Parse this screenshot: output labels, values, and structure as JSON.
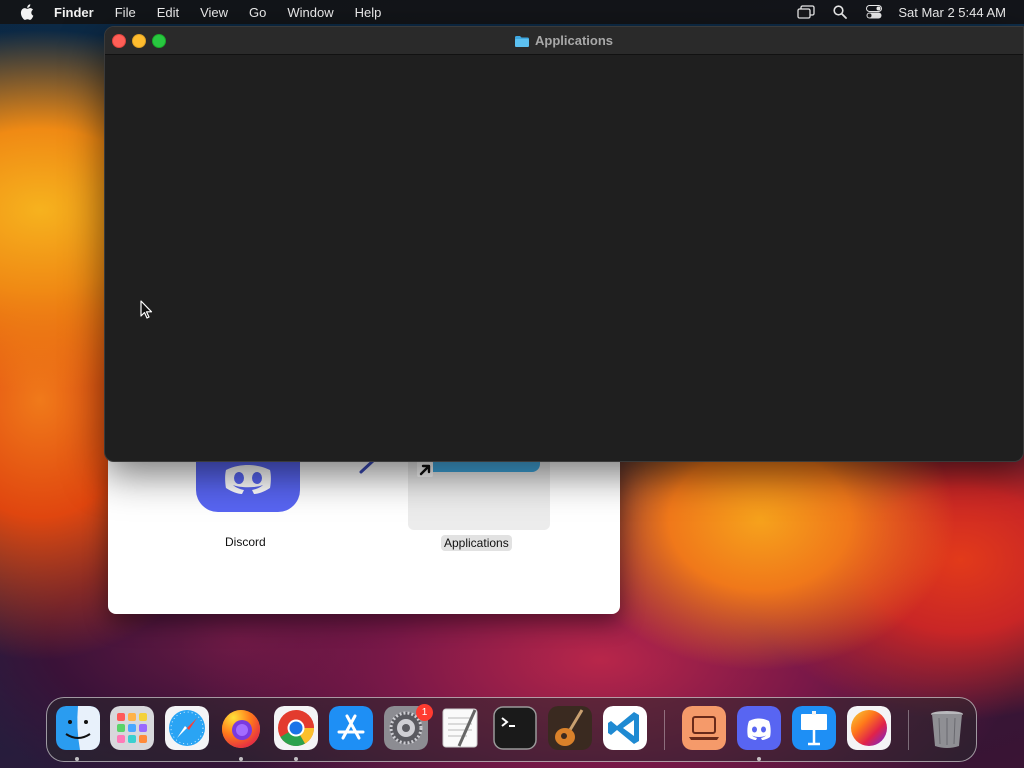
{
  "menubar": {
    "app_name": "Finder",
    "items": [
      "File",
      "Edit",
      "View",
      "Go",
      "Window",
      "Help"
    ],
    "clock": "Sat Mar 2  5:44 AM"
  },
  "finder_window": {
    "title": "Applications"
  },
  "dmg_window": {
    "app_label": "Discord",
    "folder_label": "Applications"
  },
  "dock": {
    "items": [
      {
        "name": "finder",
        "icon": "finder-icon",
        "running": true
      },
      {
        "name": "launchpad",
        "icon": "launchpad-icon",
        "running": false
      },
      {
        "name": "safari",
        "icon": "safari-icon",
        "running": false
      },
      {
        "name": "firefox",
        "icon": "firefox-icon",
        "running": true
      },
      {
        "name": "chrome",
        "icon": "chrome-icon",
        "running": true
      },
      {
        "name": "app-store",
        "icon": "app-store-icon",
        "running": false
      },
      {
        "name": "system-settings",
        "icon": "gear-icon",
        "running": false,
        "badge": "1"
      },
      {
        "name": "textedit",
        "icon": "textedit-icon",
        "running": false
      },
      {
        "name": "terminal",
        "icon": "terminal-icon",
        "running": false
      },
      {
        "name": "garageband",
        "icon": "guitar-icon",
        "running": false
      },
      {
        "name": "vscode",
        "icon": "vscode-icon",
        "running": false
      },
      {
        "name": "screen-sharing",
        "icon": "laptop-icon",
        "running": false
      },
      {
        "name": "discord",
        "icon": "discord-icon",
        "running": true
      },
      {
        "name": "keynote",
        "icon": "keynote-icon",
        "running": false
      },
      {
        "name": "color-picker",
        "icon": "color-wheel-icon",
        "running": false
      },
      {
        "name": "trash",
        "icon": "trash-icon",
        "running": false
      }
    ],
    "badge_text": "1"
  },
  "colors": {
    "window_bg": "#1f1f1f",
    "close": "#ff5f57",
    "minimize": "#febc2e",
    "maximize": "#28c840",
    "discord": "#5865f2",
    "folder_blue": "#3ea7e0"
  }
}
